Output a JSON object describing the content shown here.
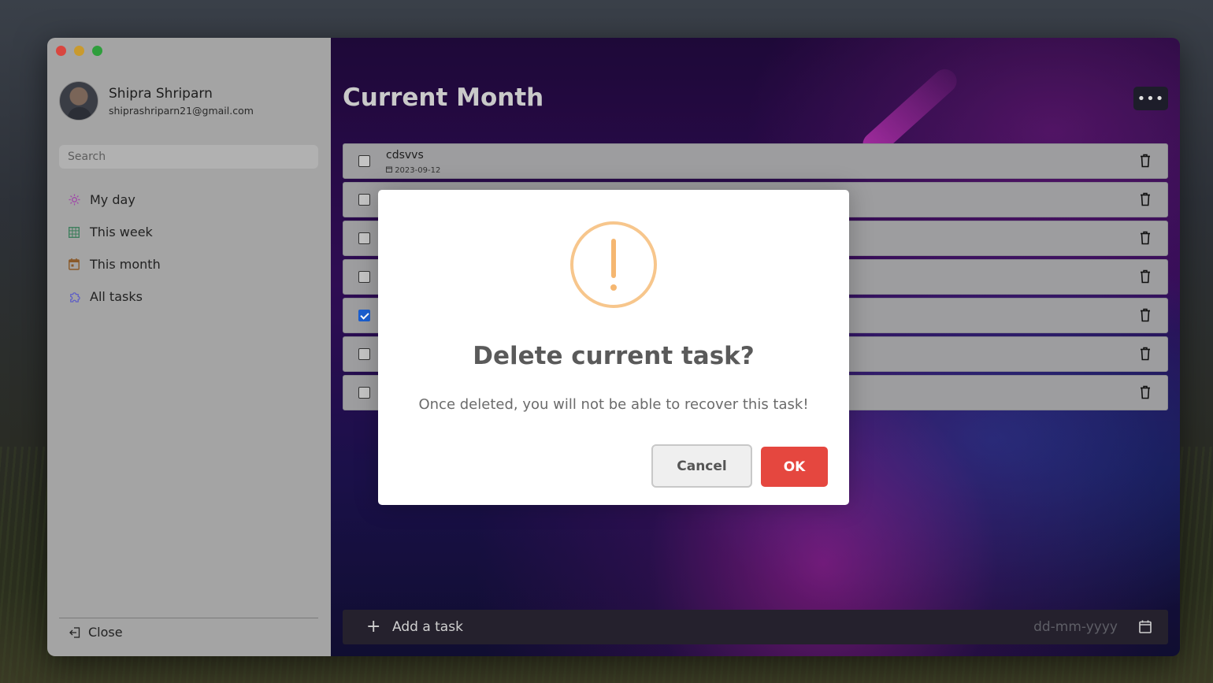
{
  "app": {
    "traffic_lights": [
      "close",
      "minimize",
      "maximize"
    ]
  },
  "profile": {
    "name": "Shipra Shriparn",
    "email": "shiprashriparn21@gmail.com"
  },
  "search": {
    "placeholder": "Search"
  },
  "sidebar": {
    "items": [
      {
        "label": "My day",
        "icon": "sun-icon"
      },
      {
        "label": "This week",
        "icon": "grid-icon"
      },
      {
        "label": "This month",
        "icon": "calendar-icon"
      },
      {
        "label": "All tasks",
        "icon": "puzzle-icon"
      }
    ],
    "close_label": "Close"
  },
  "main": {
    "title": "Current Month",
    "more_label": "•••"
  },
  "tasks": [
    {
      "title": "cdsvvs",
      "date": "2023-09-12",
      "checked": false
    },
    {
      "title": "",
      "date": "",
      "checked": false
    },
    {
      "title": "",
      "date": "",
      "checked": false
    },
    {
      "title": "",
      "date": "",
      "checked": false
    },
    {
      "title": "",
      "date": "",
      "checked": true
    },
    {
      "title": "",
      "date": "",
      "checked": false
    },
    {
      "title": "",
      "date": "",
      "checked": false
    }
  ],
  "add_task": {
    "plus": "+",
    "label": "Add a task",
    "date_placeholder": "dd-mm-yyyy"
  },
  "modal": {
    "title": "Delete current task?",
    "text": "Once deleted, you will not be able to recover this task!",
    "cancel_label": "Cancel",
    "ok_label": "OK",
    "icon": "warning-icon",
    "colors": {
      "warning": "#f7c68c",
      "ok": "#e5473f"
    }
  }
}
